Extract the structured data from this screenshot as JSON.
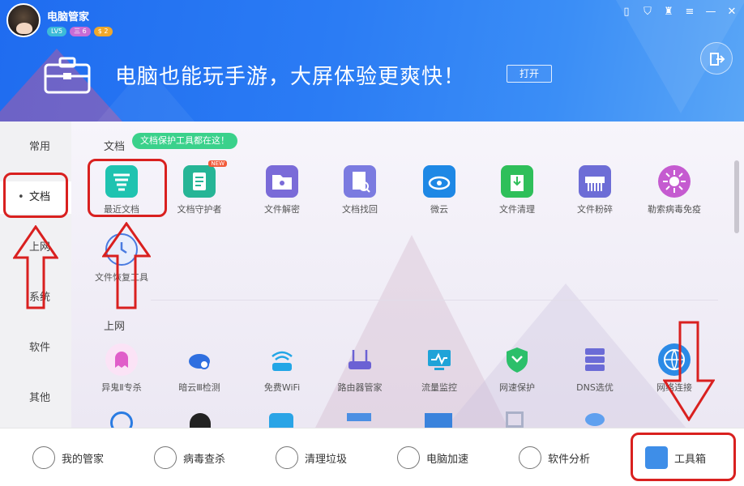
{
  "header": {
    "app_name": "电脑管家",
    "badges": [
      "LV5",
      "三 6",
      "$ 2"
    ],
    "banner_text": "电脑也能玩手游，大屏体验更爽快！",
    "open_button": "打开"
  },
  "sidebar": {
    "items": [
      {
        "label": "常用",
        "active": false
      },
      {
        "label": "文档",
        "active": true
      },
      {
        "label": "上网",
        "active": false
      },
      {
        "label": "系统",
        "active": false
      },
      {
        "label": "软件",
        "active": false
      },
      {
        "label": "其他",
        "active": false
      }
    ]
  },
  "sections": {
    "docs": {
      "title": "文档",
      "tip": "文档保护工具都在这！",
      "tools": [
        {
          "label": "最近文档",
          "icon": "recent-docs-icon",
          "color": "#1fc3b0"
        },
        {
          "label": "文档守护者",
          "icon": "doc-guardian-icon",
          "color": "#26b596",
          "tag": "NEW"
        },
        {
          "label": "文件解密",
          "icon": "file-decrypt-icon",
          "color": "#7a6bd8"
        },
        {
          "label": "文档找回",
          "icon": "doc-recover-icon",
          "color": "#7b7be0"
        },
        {
          "label": "微云",
          "icon": "weiyun-icon",
          "color": "#1e88e5"
        },
        {
          "label": "文件清理",
          "icon": "file-clean-icon",
          "color": "#2fbf5a"
        },
        {
          "label": "文件粉碎",
          "icon": "file-shred-icon",
          "color": "#6d6dd6"
        },
        {
          "label": "勒索病毒免疫",
          "icon": "ransom-immune-icon",
          "color": "#c55bd0"
        },
        {
          "label": "文件恢复工具",
          "icon": "file-restore-icon",
          "color": "#4a7be0"
        }
      ]
    },
    "net": {
      "title": "上网",
      "tools": [
        {
          "label": "异鬼Ⅱ专杀",
          "icon": "ghost-kill-icon",
          "color": "#e05ec9"
        },
        {
          "label": "暗云Ⅲ检测",
          "icon": "darkcloud-check-icon",
          "color": "#2f6fe0"
        },
        {
          "label": "免费WiFi",
          "icon": "free-wifi-icon",
          "color": "#22a6e6"
        },
        {
          "label": "路由器管家",
          "icon": "router-icon",
          "color": "#6b61d4"
        },
        {
          "label": "流量监控",
          "icon": "traffic-monitor-icon",
          "color": "#1fa3d8"
        },
        {
          "label": "网速保护",
          "icon": "speed-protect-icon",
          "color": "#2cbf6a"
        },
        {
          "label": "DNS选优",
          "icon": "dns-icon",
          "color": "#6b6bd6"
        },
        {
          "label": "网络连接",
          "icon": "network-connect-icon",
          "color": "#2b8ae6"
        }
      ]
    }
  },
  "bottom_nav": [
    {
      "label": "我的管家",
      "icon": "my-butler-icon"
    },
    {
      "label": "病毒查杀",
      "icon": "virus-scan-icon"
    },
    {
      "label": "清理垃圾",
      "icon": "clean-junk-icon"
    },
    {
      "label": "电脑加速",
      "icon": "speed-up-icon"
    },
    {
      "label": "软件分析",
      "icon": "software-analysis-icon"
    },
    {
      "label": "工具箱",
      "icon": "toolbox-icon"
    }
  ]
}
